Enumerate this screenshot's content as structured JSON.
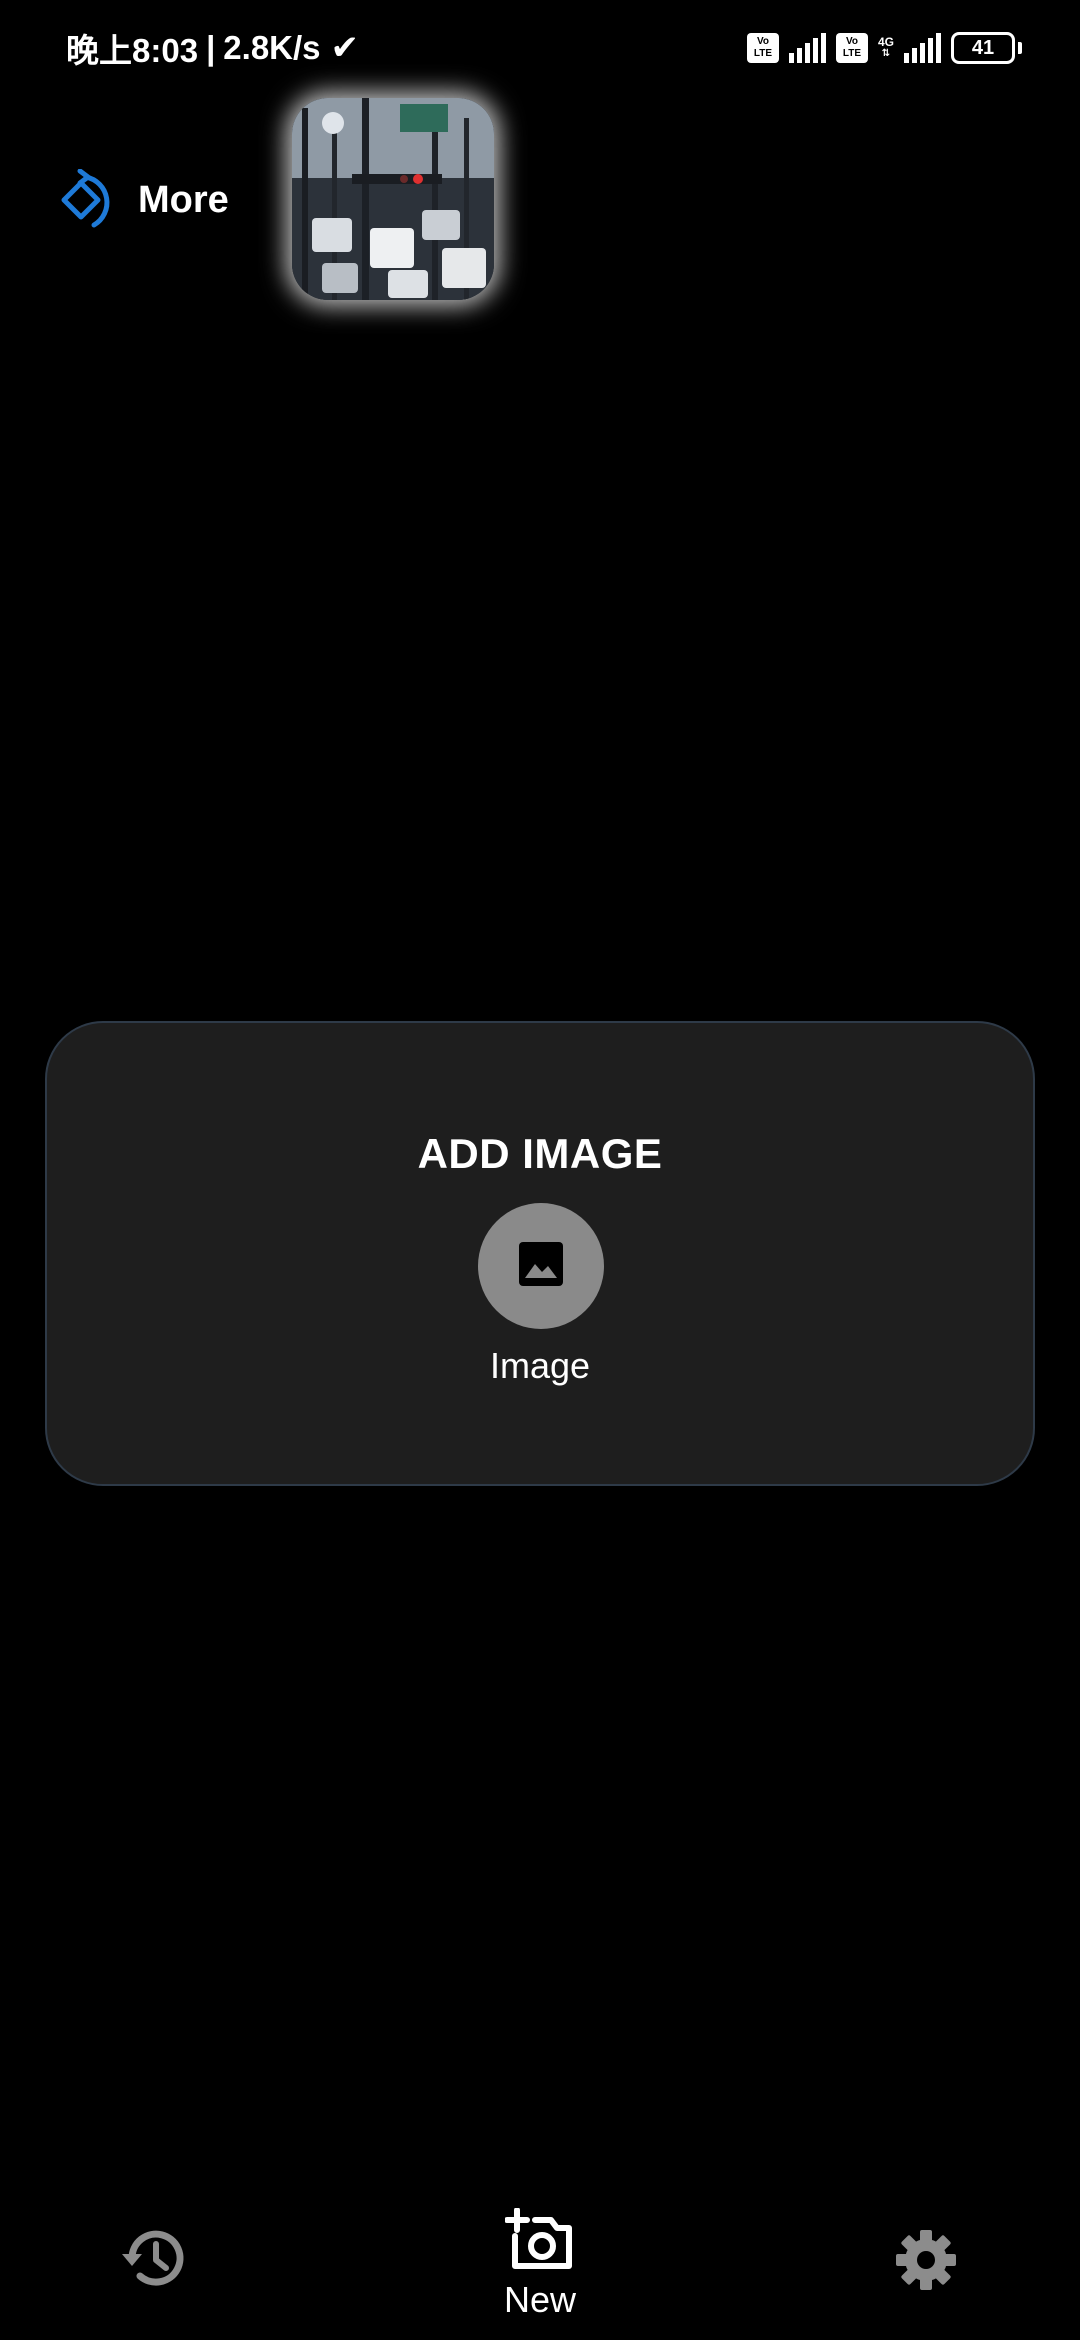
{
  "status_bar": {
    "time": "晚上8:03",
    "separator": "|",
    "speed": "2.8K/s",
    "check_icon": "check-icon",
    "sim1_badge": "Vo LTE",
    "sim2_badge": "Vo LTE",
    "network_type": "4G",
    "battery_level": "41"
  },
  "top_bar": {
    "more_label": "More",
    "more_icon": "rotate-icon",
    "accent_color": "#1e7ad8"
  },
  "card": {
    "title": "ADD IMAGE",
    "image_button_label": "Image",
    "image_icon": "image-icon"
  },
  "bottom_nav": {
    "history_icon": "history-icon",
    "new_label": "New",
    "new_icon": "add-photo-icon",
    "settings_icon": "gear-icon"
  },
  "colors": {
    "background": "#000000",
    "card_background": "#1e1e1e",
    "card_border": "#2e3a48",
    "image_button": "#8a8a8a",
    "nav_icon": "#8c8c8c"
  }
}
